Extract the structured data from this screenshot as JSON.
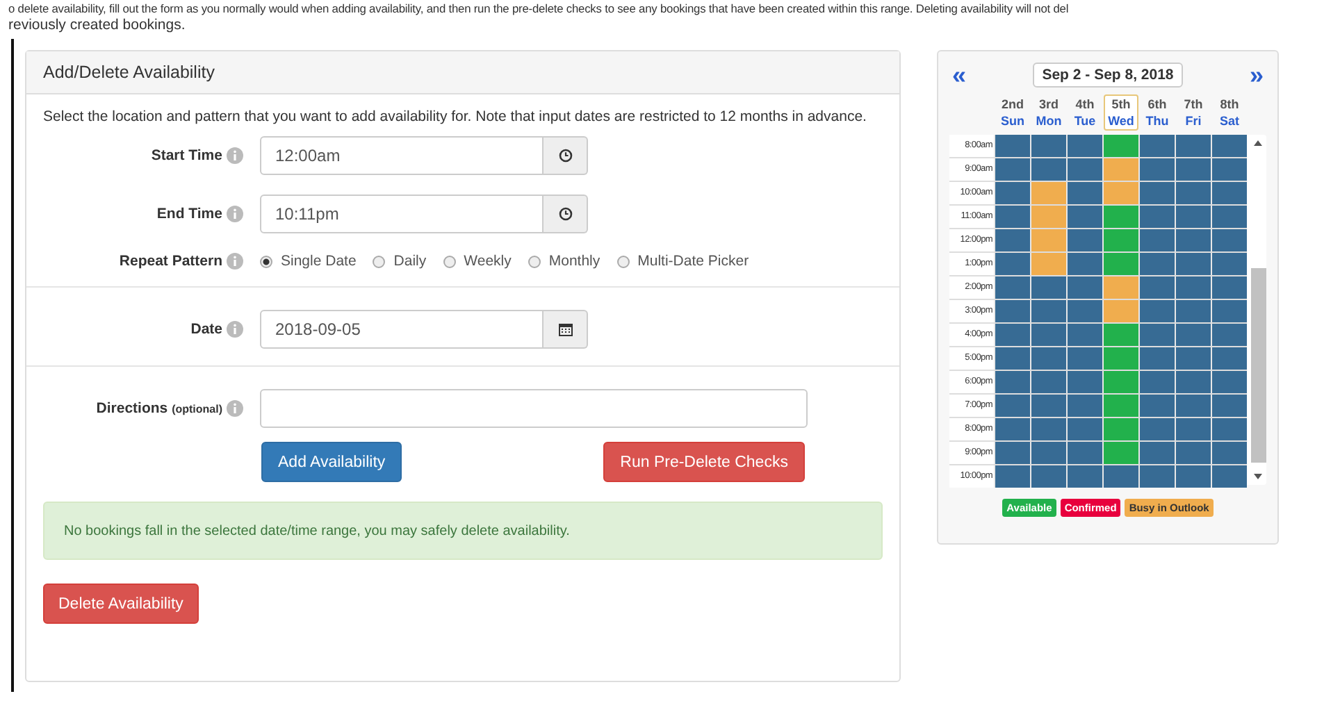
{
  "intro": {
    "lines": [
      "o delete availability, fill out the form as you normally would when adding availability, and then run the pre-delete checks to see any bookings that have been created within this range. Deleting availability will not del",
      "reviously created bookings."
    ]
  },
  "panel": {
    "title": "Add/Delete Availability",
    "description": "Select the location and pattern that you want to add availability for. Note that input dates are restricted to 12 months in advance.",
    "start_time": {
      "label": "Start Time",
      "value": "12:00am"
    },
    "end_time": {
      "label": "End Time",
      "value": "10:11pm"
    },
    "repeat_pattern": {
      "label": "Repeat Pattern",
      "options": [
        {
          "label": "Single Date",
          "selected": true
        },
        {
          "label": "Daily",
          "selected": false
        },
        {
          "label": "Weekly",
          "selected": false
        },
        {
          "label": "Monthly",
          "selected": false
        },
        {
          "label": "Multi-Date Picker",
          "selected": false
        }
      ]
    },
    "date": {
      "label": "Date",
      "value": "2018-09-05"
    },
    "directions": {
      "label": "Directions",
      "hint": "(optional)"
    },
    "buttons": [
      {
        "label": "Add Availability",
        "kind": "primary"
      },
      {
        "label": "Run Pre-Delete Checks",
        "kind": "danger"
      }
    ],
    "alert": "No bookings fall in the selected date/time range, you may safely delete availability.",
    "delete_button": "Delete Availability"
  },
  "calendar": {
    "prev": "«",
    "next": "»",
    "range": "Sep 2 - Sep 8, 2018",
    "days": [
      {
        "date": "2nd",
        "day": "Sun",
        "selected": false
      },
      {
        "date": "3rd",
        "day": "Mon",
        "selected": false
      },
      {
        "date": "4th",
        "day": "Tue",
        "selected": false
      },
      {
        "date": "5th",
        "day": "Wed",
        "selected": true
      },
      {
        "date": "6th",
        "day": "Thu",
        "selected": false
      },
      {
        "date": "7th",
        "day": "Fri",
        "selected": false
      },
      {
        "date": "8th",
        "day": "Sat",
        "selected": false
      }
    ],
    "rows": [
      {
        "time": "8:00am",
        "cells": [
          {
            "kind": "open"
          },
          {
            "kind": "open"
          },
          {
            "kind": "open"
          },
          {
            "kind": "available"
          },
          {
            "kind": "open"
          },
          {
            "kind": "open"
          },
          {
            "kind": "open"
          }
        ]
      },
      {
        "time": "9:00am",
        "cells": [
          {
            "kind": "open"
          },
          {
            "kind": "open"
          },
          {
            "kind": "open"
          },
          {
            "kind": "busy"
          },
          {
            "kind": "open"
          },
          {
            "kind": "open"
          },
          {
            "kind": "open"
          }
        ]
      },
      {
        "time": "10:00am",
        "cells": [
          {
            "kind": "open"
          },
          {
            "kind": "busy"
          },
          {
            "kind": "open"
          },
          {
            "kind": "busy"
          },
          {
            "kind": "open"
          },
          {
            "kind": "open"
          },
          {
            "kind": "open"
          }
        ]
      },
      {
        "time": "11:00am",
        "cells": [
          {
            "kind": "open"
          },
          {
            "kind": "busy"
          },
          {
            "kind": "open"
          },
          {
            "kind": "available"
          },
          {
            "kind": "open"
          },
          {
            "kind": "open"
          },
          {
            "kind": "open"
          }
        ]
      },
      {
        "time": "12:00pm",
        "cells": [
          {
            "kind": "open"
          },
          {
            "kind": "busy"
          },
          {
            "kind": "open"
          },
          {
            "kind": "available"
          },
          {
            "kind": "open"
          },
          {
            "kind": "open"
          },
          {
            "kind": "open"
          }
        ]
      },
      {
        "time": "1:00pm",
        "cells": [
          {
            "kind": "open"
          },
          {
            "kind": "busy"
          },
          {
            "kind": "open"
          },
          {
            "kind": "available"
          },
          {
            "kind": "open"
          },
          {
            "kind": "open"
          },
          {
            "kind": "open"
          }
        ]
      },
      {
        "time": "2:00pm",
        "cells": [
          {
            "kind": "open"
          },
          {
            "kind": "open"
          },
          {
            "kind": "open"
          },
          {
            "kind": "busy"
          },
          {
            "kind": "open"
          },
          {
            "kind": "open"
          },
          {
            "kind": "open"
          }
        ]
      },
      {
        "time": "3:00pm",
        "cells": [
          {
            "kind": "open"
          },
          {
            "kind": "open"
          },
          {
            "kind": "open"
          },
          {
            "kind": "busy"
          },
          {
            "kind": "open"
          },
          {
            "kind": "open"
          },
          {
            "kind": "open"
          }
        ]
      },
      {
        "time": "4:00pm",
        "cells": [
          {
            "kind": "open"
          },
          {
            "kind": "open"
          },
          {
            "kind": "open"
          },
          {
            "kind": "available"
          },
          {
            "kind": "open"
          },
          {
            "kind": "open"
          },
          {
            "kind": "open"
          }
        ]
      },
      {
        "time": "5:00pm",
        "cells": [
          {
            "kind": "open"
          },
          {
            "kind": "open"
          },
          {
            "kind": "open"
          },
          {
            "kind": "available"
          },
          {
            "kind": "open"
          },
          {
            "kind": "open"
          },
          {
            "kind": "open"
          }
        ]
      },
      {
        "time": "6:00pm",
        "cells": [
          {
            "kind": "open"
          },
          {
            "kind": "open"
          },
          {
            "kind": "open"
          },
          {
            "kind": "available"
          },
          {
            "kind": "open"
          },
          {
            "kind": "open"
          },
          {
            "kind": "open"
          }
        ]
      },
      {
        "time": "7:00pm",
        "cells": [
          {
            "kind": "open"
          },
          {
            "kind": "open"
          },
          {
            "kind": "open"
          },
          {
            "kind": "available"
          },
          {
            "kind": "open"
          },
          {
            "kind": "open"
          },
          {
            "kind": "open"
          }
        ]
      },
      {
        "time": "8:00pm",
        "cells": [
          {
            "kind": "open"
          },
          {
            "kind": "open"
          },
          {
            "kind": "open"
          },
          {
            "kind": "available"
          },
          {
            "kind": "open"
          },
          {
            "kind": "open"
          },
          {
            "kind": "open"
          }
        ]
      },
      {
        "time": "9:00pm",
        "cells": [
          {
            "kind": "open"
          },
          {
            "kind": "open"
          },
          {
            "kind": "open"
          },
          {
            "kind": "available"
          },
          {
            "kind": "open"
          },
          {
            "kind": "open"
          },
          {
            "kind": "open"
          }
        ]
      },
      {
        "time": "10:00pm",
        "cells": [
          {
            "kind": "open"
          },
          {
            "kind": "open"
          },
          {
            "kind": "open"
          },
          {
            "kind": "open"
          },
          {
            "kind": "open"
          },
          {
            "kind": "open"
          },
          {
            "kind": "open"
          }
        ]
      }
    ],
    "legend": [
      {
        "label": "Available",
        "color": "#22b14c"
      },
      {
        "label": "Confirmed",
        "color": "#e8003d"
      },
      {
        "label": "Busy in Outlook",
        "color": "#f0ad4e"
      }
    ]
  }
}
